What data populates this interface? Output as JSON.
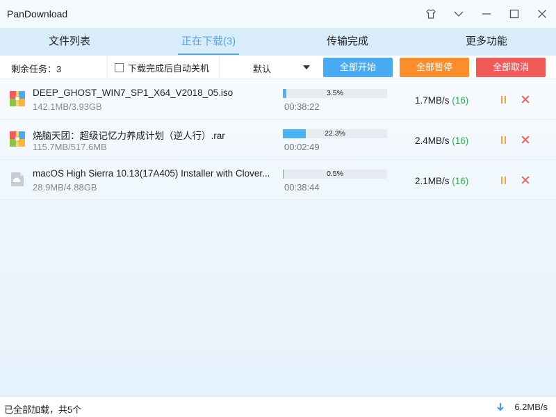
{
  "window": {
    "title": "PanDownload"
  },
  "tabs": [
    {
      "label": "文件列表"
    },
    {
      "label": "正在下载(3)"
    },
    {
      "label": "传输完成"
    },
    {
      "label": "更多功能"
    }
  ],
  "toolbar": {
    "remaining_tasks": "剩余任务：3",
    "auto_shutdown_label": "下载完成后自动关机",
    "auto_shutdown_checked": false,
    "sort_select_value": "默认",
    "start_all_label": "全部开始",
    "pause_all_label": "全部暂停",
    "cancel_all_label": "全部取消"
  },
  "downloads": [
    {
      "name": "DEEP_GHOST_WIN7_SP1_X64_V2018_05.iso",
      "size": "142.1MB/3.93GB",
      "progress_text": "3.5%",
      "progress": 0.035,
      "eta": "00:38:22",
      "speed": "1.7MB/s",
      "connections": "(16)",
      "icon": "archive-file-icon"
    },
    {
      "name": "烧脑天团：超级记忆力养成计划（逆人行）.rar",
      "size": "115.7MB/517.6MB",
      "progress_text": "22.3%",
      "progress": 0.223,
      "eta": "00:02:49",
      "speed": "2.4MB/s",
      "connections": "(16)",
      "icon": "archive-file-icon"
    },
    {
      "name": "macOS High Sierra 10.13(17A405) Installer with Clover...",
      "size": "28.9MB/4.88GB",
      "progress_text": "0.5%",
      "progress": 0.005,
      "eta": "00:38:44",
      "speed": "2.1MB/s",
      "connections": "(16)",
      "icon": "cloud-file-icon"
    }
  ],
  "statusbar": {
    "left_text": "已全部加载，共5个",
    "total_speed": "6.2MB/s"
  },
  "colors": {
    "accent": "#56a6ea",
    "start": "#4aabf5",
    "pause": "#fb8d2c",
    "cancel": "#f25a5a",
    "connections": "#2bb24c",
    "progress": "#48b4f2"
  }
}
